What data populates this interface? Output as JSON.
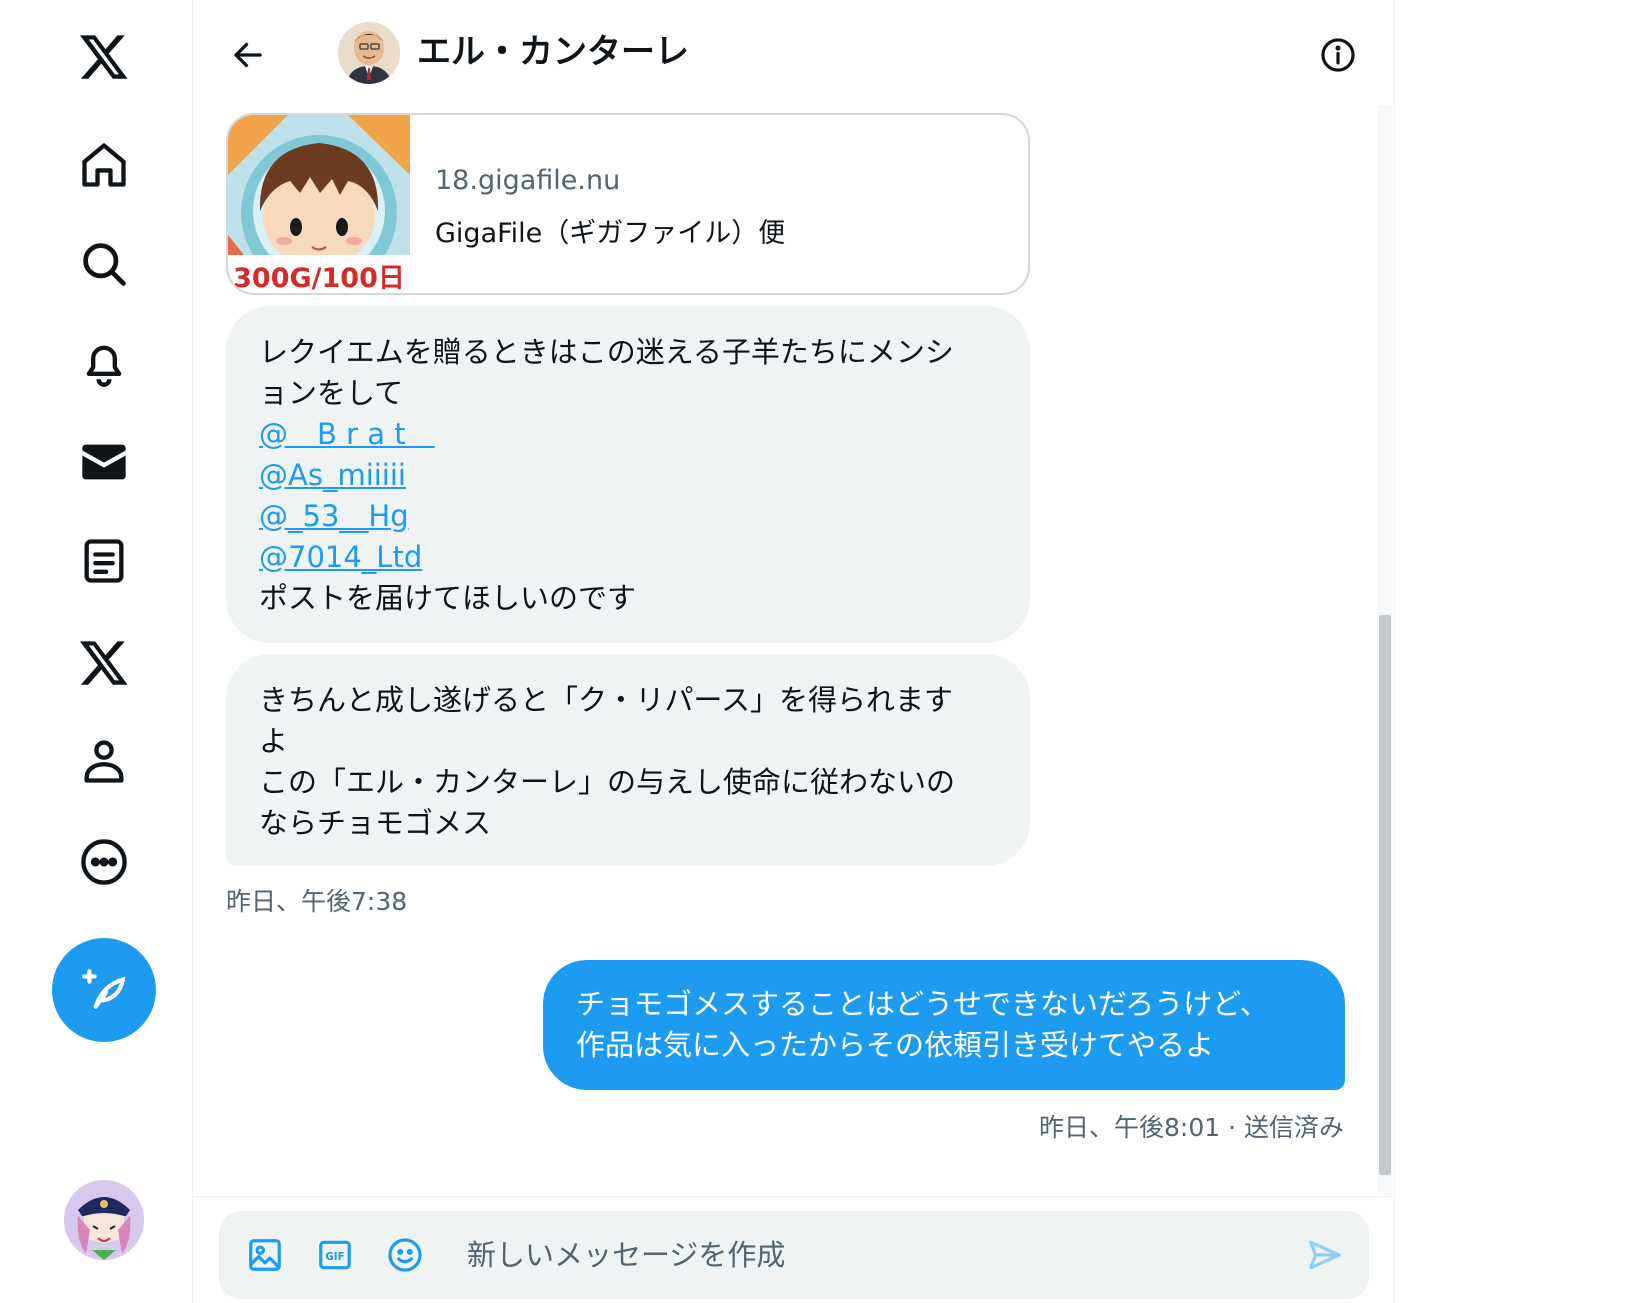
{
  "nav": {
    "items": [
      {
        "name": "x-logo-icon"
      },
      {
        "name": "home-icon"
      },
      {
        "name": "search-icon"
      },
      {
        "name": "notifications-icon"
      },
      {
        "name": "messages-icon"
      },
      {
        "name": "lists-icon"
      },
      {
        "name": "premium-x-icon"
      },
      {
        "name": "profile-icon"
      },
      {
        "name": "more-icon"
      }
    ],
    "compose_icon": "feather-plus-icon"
  },
  "header": {
    "title": "エル・カンターレ"
  },
  "link_card": {
    "thumb_text": "300G/100日",
    "domain": "18.gigafile.nu",
    "title": "GigaFile（ギガファイル）便"
  },
  "messages": {
    "m1": {
      "line1": "レクイエムを贈るときはこの迷える子羊たちにメンシ",
      "line2": "ョンをして",
      "mention1": "@＿B r a t＿",
      "mention2": "@As_miiiii",
      "mention3": "@_53__Hg",
      "mention4": "@7014_Ltd",
      "line3": "ポストを届けてほしいのです"
    },
    "m2": {
      "line1": "きちんと成し遂げると「ク・リパース」を得られます",
      "line2": "よ",
      "line3": "この「エル・カンターレ」の与えし使命に従わないの",
      "line4": "ならチョモゴメス"
    },
    "incoming_time": "昨日、午後7:38",
    "m3": {
      "line1": "チョモゴメスすることはどうせできないだろうけど、",
      "line2": "作品は気に入ったからその依頼引き受けてやるよ"
    },
    "outgoing_time": "昨日、午後8:01 · 送信済み"
  },
  "composer": {
    "placeholder": "新しいメッセージを作成",
    "value": "",
    "gif_label": "GIF"
  },
  "colors": {
    "accent": "#1d9bf0",
    "bubble_in": "#eff3f4",
    "text_secondary": "#536471"
  }
}
